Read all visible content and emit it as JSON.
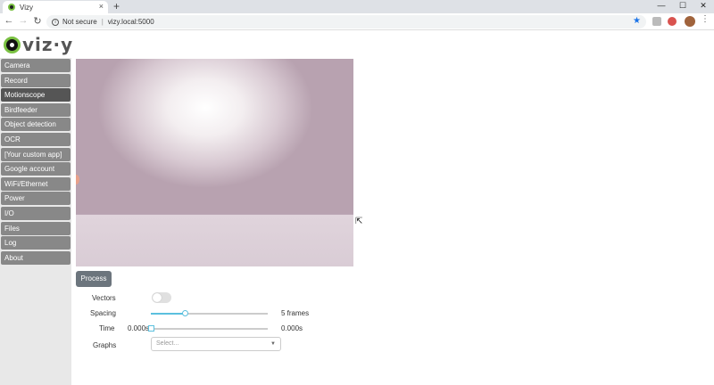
{
  "browser": {
    "tab_title": "Vizy",
    "tab_close": "×",
    "new_tab": "+",
    "win_minimize": "—",
    "win_maximize": "☐",
    "win_close": "✕",
    "security_label": "Not secure",
    "url": "vizy.local:5000"
  },
  "app": {
    "logo_text": "viz·y"
  },
  "sidebar": {
    "items": [
      {
        "label": "Camera"
      },
      {
        "label": "Record"
      },
      {
        "label": "Motionscope"
      },
      {
        "label": "Birdfeeder"
      },
      {
        "label": "Object detection"
      },
      {
        "label": "OCR"
      },
      {
        "label": "[Your custom app]"
      },
      {
        "label": "Google account"
      },
      {
        "label": "WiFi/Ethernet"
      },
      {
        "label": "Power"
      },
      {
        "label": "I/O"
      },
      {
        "label": "Files"
      },
      {
        "label": "Log"
      },
      {
        "label": "About"
      }
    ],
    "active": "Motionscope"
  },
  "controls": {
    "process_label": "Process",
    "vectors_label": "Vectors",
    "vectors_on": false,
    "spacing_label": "Spacing",
    "spacing_value": "5 frames",
    "spacing_fraction": 0.3,
    "time_label": "Time",
    "time_start": "0.000s",
    "time_end": "0.000s",
    "graphs_label": "Graphs",
    "graphs_placeholder": "Select..."
  },
  "colors": {
    "accent": "#5bc0de",
    "sidebar_item": "#888888",
    "sidebar_active": "#555555",
    "logo_green": "#7ac142"
  }
}
